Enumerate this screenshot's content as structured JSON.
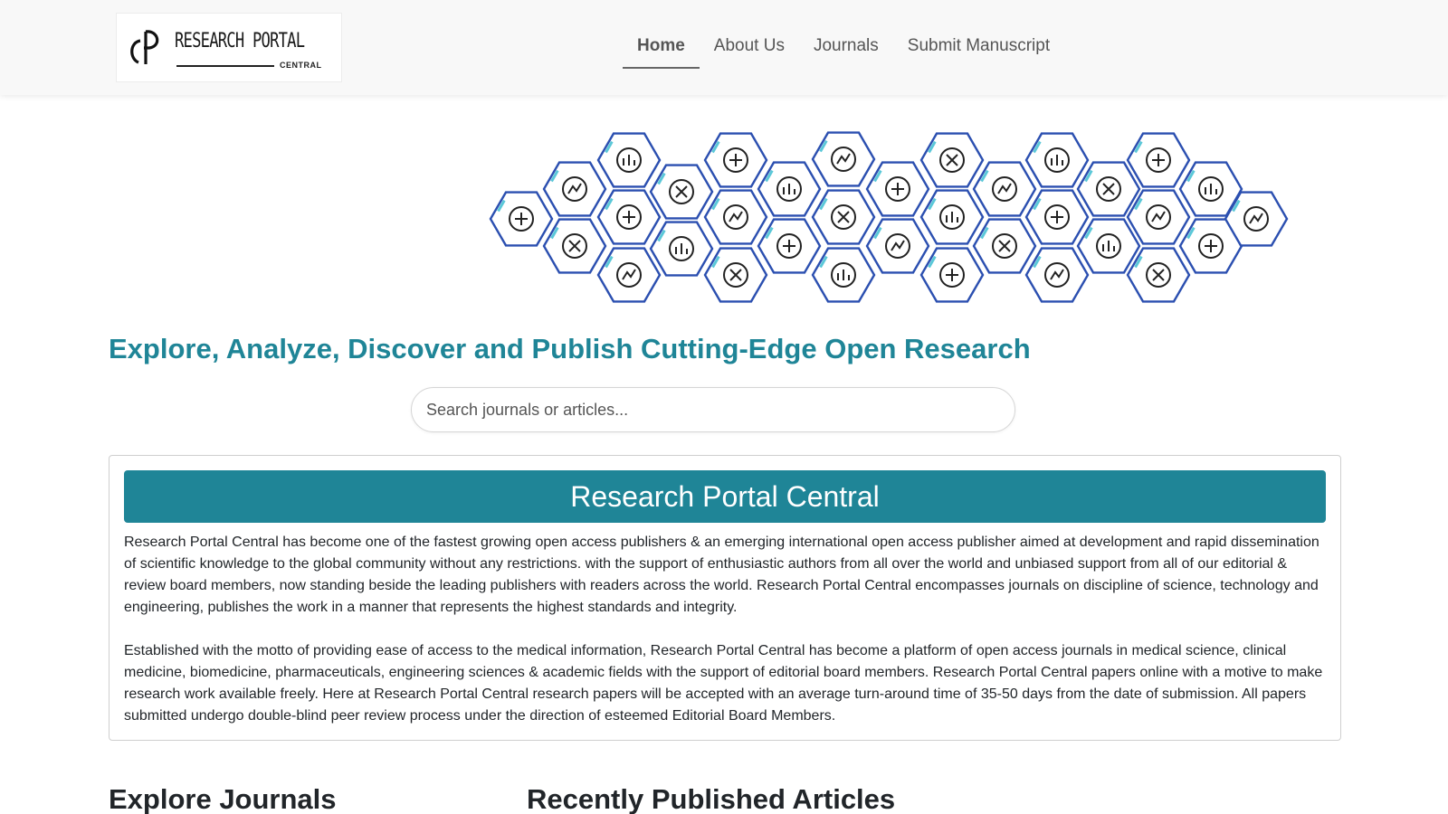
{
  "logo": {
    "main": "RESEARCH PORTAL",
    "sub": "CENTRAL"
  },
  "nav": {
    "items": [
      {
        "label": "Home",
        "active": true
      },
      {
        "label": "About Us",
        "active": false
      },
      {
        "label": "Journals",
        "active": false
      },
      {
        "label": "Submit Manuscript",
        "active": false
      }
    ]
  },
  "banner": {
    "icons": [
      "caduceus-icon",
      "doctor-icon",
      "museum-icon",
      "gears-icon",
      "heart-icon",
      "virus-icon",
      "lab-flask-icon",
      "earth-icon",
      "rocket-icon",
      "tooth-icon",
      "brain-icon",
      "atom-icon",
      "paw-icon",
      "engineer-icon",
      "code-monitor-icon",
      "architecture-icon",
      "document-icon",
      "network-icon",
      "plants-icon",
      "idea-chart-icon",
      "scientist-icon",
      "molecule-arrows-icon",
      "factory-icon",
      "lab-skull-icon",
      "lungs-icon",
      "bone-icon",
      "kidneys-icon",
      "gender-icon",
      "cells-icon",
      "medical-person-icon",
      "clipboard-hourglass-icon",
      "baby-icon",
      "liver-icon",
      "stomach-icon"
    ]
  },
  "hero": {
    "title": "Explore, Analyze, Discover and Publish Cutting-Edge Open Research"
  },
  "search": {
    "placeholder": "Search journals or articles...",
    "value": ""
  },
  "about": {
    "heading": "Research Portal Central",
    "paragraphs": [
      "Research Portal Central has become one of the fastest growing open access publishers & an emerging international open access publisher aimed at development and rapid dissemination of scientific knowledge to the global community without any restrictions. with the support of enthusiastic authors from all over the world and unbiased support from all of our editorial & review board members, now standing beside the leading publishers with readers across the world. Research Portal Central encompasses journals on discipline of science, technology and engineering, publishes the work in a manner that represents the highest standards and integrity.",
      "Established with the motto of providing ease of access to the medical information, Research Portal Central has become a platform of open access journals in medical science, clinical medicine, biomedicine, pharmaceuticals, engineering sciences & academic fields with the support of editorial board members. Research Portal Central papers online with a motive to make research work available freely. Here at Research Portal Central research papers will be accepted with an average turn-around time of 35-50 days from the date of submission. All papers submitted undergo double-blind peer review process under the direction of esteemed Editorial Board Members."
    ]
  },
  "sections": {
    "explore_journals": "Explore Journals",
    "recent_articles": "Recently Published Articles"
  },
  "colors": {
    "accent": "#1f8597",
    "hex_border": "#2b4fb0",
    "hex_accent": "#5bc8d8"
  }
}
